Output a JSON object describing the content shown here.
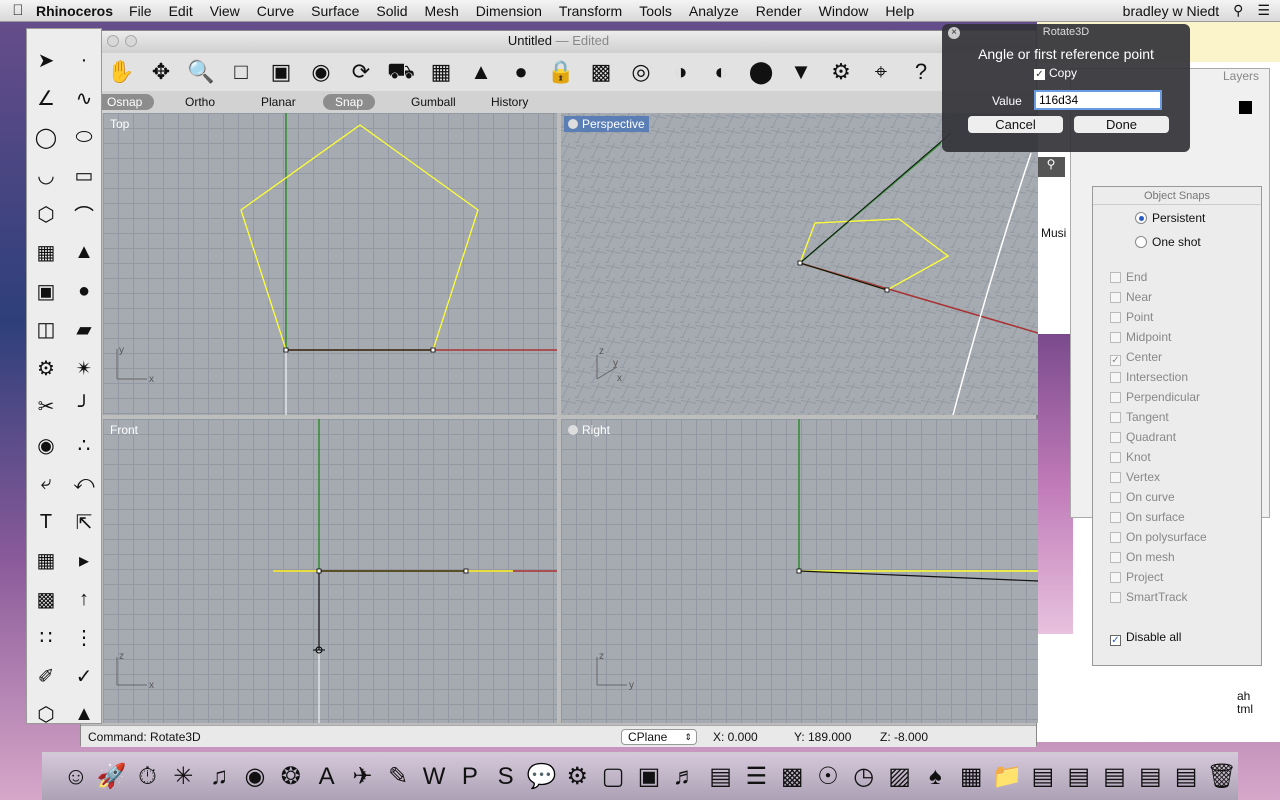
{
  "menubar": {
    "app_name": "Rhinoceros",
    "items": [
      "File",
      "Edit",
      "View",
      "Curve",
      "Surface",
      "Solid",
      "Mesh",
      "Dimension",
      "Transform",
      "Tools",
      "Analyze",
      "Render",
      "Window",
      "Help"
    ],
    "user": "bradley w Niedt"
  },
  "window": {
    "title": "Untitled",
    "edited": "— Edited"
  },
  "status_toggles": {
    "osnap": "Osnap",
    "ortho": "Ortho",
    "planar": "Planar",
    "snap": "Snap",
    "gumball": "Gumball",
    "history": "History"
  },
  "viewports": {
    "top": "Top",
    "perspective": "Perspective",
    "front": "Front",
    "right": "Right"
  },
  "command_bar": {
    "command": "Command:  Rotate3D",
    "cplane": "CPlane",
    "x": "X: 0.000",
    "y": "Y: 189.000",
    "z": "Z: -8.000"
  },
  "rotate_dialog": {
    "title": "Rotate3D",
    "prompt": "Angle or first reference point",
    "copy_label": "Copy",
    "copy_checked": true,
    "value_label": "Value",
    "value": "116d34",
    "cancel": "Cancel",
    "done": "Done"
  },
  "object_snaps": {
    "title": "Object Snaps",
    "persistent": "Persistent",
    "one_shot": "One shot",
    "snaps": [
      "End",
      "Near",
      "Point",
      "Midpoint",
      "Center",
      "Intersection",
      "Perpendicular",
      "Tangent",
      "Quadrant",
      "Knot",
      "Vertex",
      "On curve",
      "On surface",
      "On polysurface",
      "On mesh",
      "Project",
      "SmartTrack"
    ],
    "center_checked": true,
    "disable_all": "Disable all"
  },
  "background": {
    "layers_label": "Layers",
    "music_text": "Musi",
    "ah_text": "ah",
    "tml_text": "tml"
  },
  "colors": {
    "curve": "#ffff33",
    "x_axis": "#a83232",
    "y_axis": "#2e8b2e",
    "viewport_bg": "#a6abb2",
    "active_label": "#5b7fb4"
  }
}
